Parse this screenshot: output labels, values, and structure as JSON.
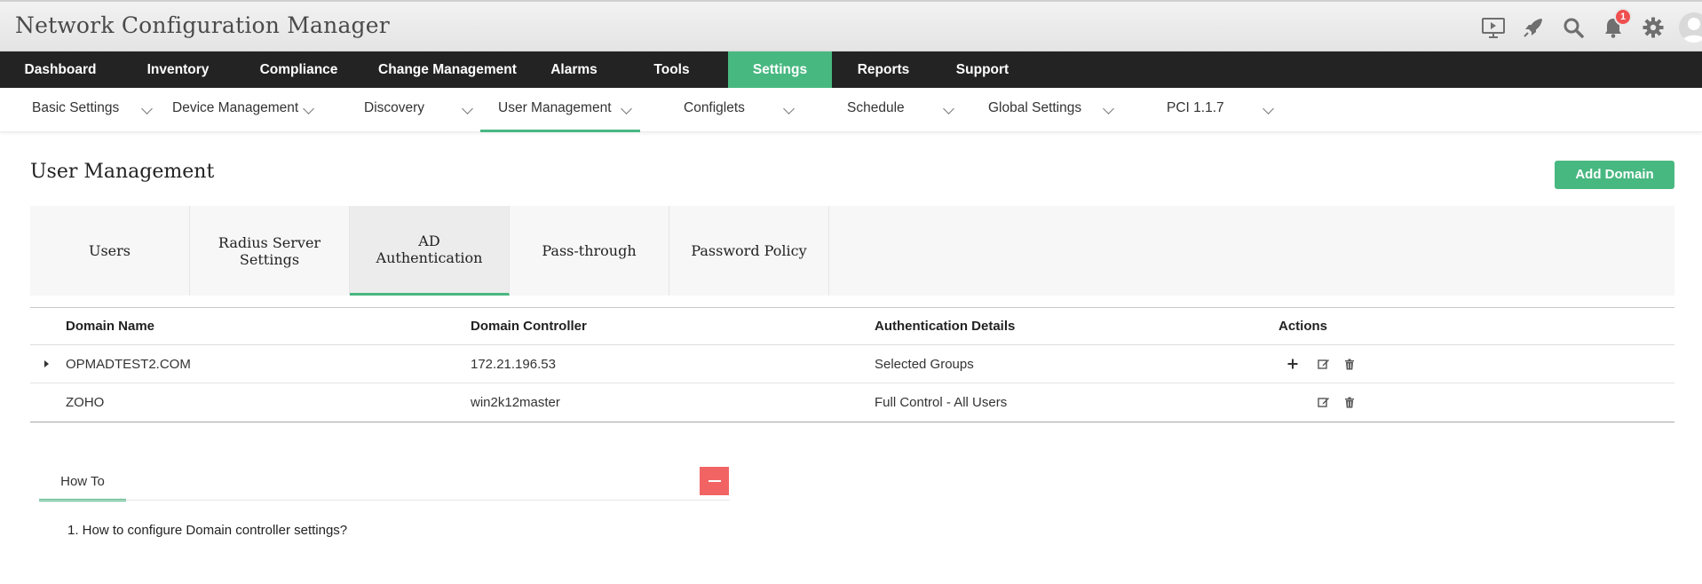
{
  "app": {
    "title": "Network Configuration Manager"
  },
  "header": {
    "notification_count": "1",
    "icons": [
      "presentation-icon",
      "rocket-icon",
      "search-icon",
      "bell-icon",
      "gear-icon",
      "user-avatar-icon"
    ]
  },
  "main_nav": {
    "items": [
      {
        "label": "Dashboard"
      },
      {
        "label": "Inventory"
      },
      {
        "label": "Compliance"
      },
      {
        "label": "Change Management"
      },
      {
        "label": "Alarms"
      },
      {
        "label": "Tools"
      },
      {
        "label": "Settings"
      },
      {
        "label": "Reports"
      },
      {
        "label": "Support"
      }
    ],
    "active": "Settings"
  },
  "sub_nav": {
    "items": [
      {
        "label": "Basic Settings"
      },
      {
        "label": "Device Management"
      },
      {
        "label": "Discovery"
      },
      {
        "label": "User Management"
      },
      {
        "label": "Configlets"
      },
      {
        "label": "Schedule"
      },
      {
        "label": "Global Settings"
      },
      {
        "label": "PCI 1.1.7"
      }
    ],
    "active": "User Management"
  },
  "page": {
    "title": "User Management",
    "add_button": "Add Domain"
  },
  "tabs": {
    "items": [
      {
        "label": "Users"
      },
      {
        "label": "Radius Server Settings"
      },
      {
        "label": "AD Authentication"
      },
      {
        "label": "Pass-through"
      },
      {
        "label": "Password Policy"
      }
    ],
    "active": "AD Authentication"
  },
  "table": {
    "columns": [
      "Domain Name",
      "Domain Controller",
      "Authentication Details",
      "Actions"
    ],
    "rows": [
      {
        "domain": "OPMADTEST2.COM",
        "controller": "172.21.196.53",
        "auth": "Selected Groups",
        "expandable": true,
        "actions": [
          "add-icon",
          "edit-icon",
          "delete-icon"
        ]
      },
      {
        "domain": "ZOHO",
        "controller": "win2k12master",
        "auth": "Full Control - All Users",
        "expandable": false,
        "actions": [
          "edit-icon",
          "delete-icon"
        ]
      }
    ]
  },
  "howto": {
    "tab_label": "How To",
    "items": [
      "1. How to configure Domain controller settings?"
    ]
  },
  "colors": {
    "accent": "#48b881",
    "nav_bg": "#232323",
    "badge": "#ef4f4f",
    "collapse_button": "#f26464"
  }
}
